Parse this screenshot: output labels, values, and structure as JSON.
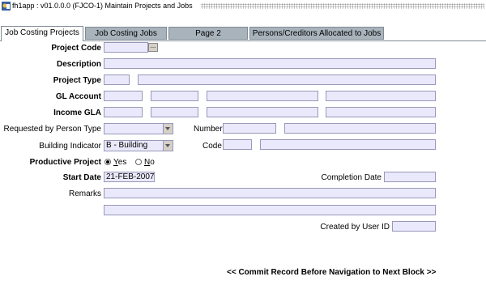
{
  "window": {
    "title": "fh1app : v01.0.0.0 (FJCO-1) Maintain Projects and Jobs"
  },
  "tabs": [
    {
      "label": "Job Costing Projects",
      "active": true
    },
    {
      "label": "Job Costing Jobs",
      "active": false
    },
    {
      "label": "Page 2",
      "active": false
    },
    {
      "label": "Persons/Creditors Allocated to Jobs",
      "active": false
    }
  ],
  "form": {
    "project_code": {
      "label": "Project Code",
      "value": "",
      "lov": "..."
    },
    "description": {
      "label": "Description",
      "value": ""
    },
    "project_type": {
      "label": "Project Type",
      "code": "",
      "desc": ""
    },
    "gl_account": {
      "label": "GL Account",
      "values": [
        "",
        "",
        "",
        ""
      ]
    },
    "income_gla": {
      "label": "Income GLA",
      "values": [
        "",
        "",
        "",
        ""
      ]
    },
    "requested_by": {
      "label": "Requested by Person Type",
      "value": ""
    },
    "number": {
      "label": "Number",
      "code": "",
      "desc": ""
    },
    "building_indicator": {
      "label": "Building Indicator",
      "value": "B - Building"
    },
    "code": {
      "label": "Code",
      "code": "",
      "desc": ""
    },
    "productive_project": {
      "label": "Productive Project",
      "yes_label": "Yes",
      "no_label": "No",
      "selected": "yes"
    },
    "start_date": {
      "label": "Start Date",
      "value": "21-FEB-2007"
    },
    "completion_date": {
      "label": "Completion Date",
      "value": ""
    },
    "remarks": {
      "label": "Remarks",
      "line1": "",
      "line2": ""
    },
    "created_by": {
      "label": "Created by User ID",
      "value": ""
    }
  },
  "footer": {
    "nav_message": "<< Commit Record Before Navigation to Next Block >>"
  },
  "colors": {
    "field_bg": "#eae8fb",
    "tab_bg": "#a9b3bc"
  }
}
